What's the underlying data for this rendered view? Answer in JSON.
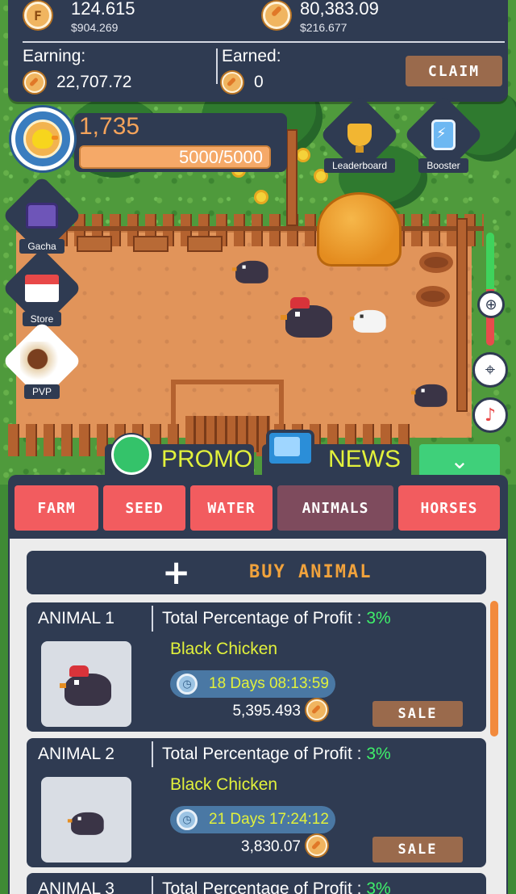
{
  "top_bar": {
    "token_value": "124.615",
    "token_usd": "$904.269",
    "carrot_value": "80,383.09",
    "carrot_usd": "$216.677",
    "earning_label": "Earning:",
    "earning_value": "22,707.72",
    "earned_label": "Earned:",
    "earned_value": "0",
    "claim_label": "CLAIM",
    "token_icon": "F"
  },
  "player": {
    "level": "1,735",
    "xp_text": "5000/5000",
    "xp_fraction": 1.0
  },
  "side_menu": {
    "gacha": "Gacha",
    "store": "Store",
    "pvp": "PVP",
    "leaderboard": "Leaderboard",
    "booster": "Booster"
  },
  "controls": {
    "zoom_icon": "magnifier-plus-icon",
    "locate_icon": "crosshair-icon",
    "music_icon": "music-note-icon"
  },
  "strip": {
    "promo": "PROMO",
    "news": "NEWS"
  },
  "tabs": [
    {
      "label": "FARM"
    },
    {
      "label": "SEED"
    },
    {
      "label": "WATER"
    },
    {
      "label": "ANIMALS"
    },
    {
      "label": "HORSES"
    }
  ],
  "buy_animal_label": "BUY ANIMAL",
  "animals": [
    {
      "title": "ANIMAL 1",
      "profit_label": "Total Percentage of Profit :",
      "profit_value": "3%",
      "name": "Black Chicken",
      "timer": "18 Days 08:13:59",
      "price": "5,395.493",
      "sale_label": "SALE"
    },
    {
      "title": "ANIMAL 2",
      "profit_label": "Total Percentage of Profit :",
      "profit_value": "3%",
      "name": "Black Chicken",
      "timer": "21 Days 17:24:12",
      "price": "3,830.07",
      "sale_label": "SALE"
    },
    {
      "title": "ANIMAL 3",
      "profit_label": "Total Percentage of Profit :",
      "profit_value": "3%"
    }
  ],
  "colors": {
    "panel": "#2f3b52",
    "tab_red": "#f25c5f",
    "tab_active": "#7e4b5d",
    "accent_yellow": "#e2f13b",
    "accent_green": "#3ff06a",
    "sale_brown": "#9a6a4c"
  }
}
